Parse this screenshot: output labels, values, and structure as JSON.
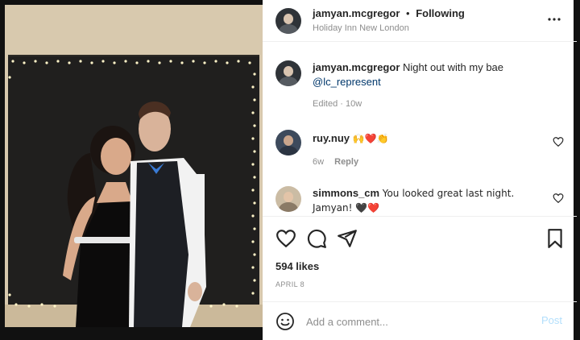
{
  "post": {
    "author": "jamyan.mcgregor",
    "separator": "•",
    "follow_status": "Following",
    "location": "Holiday Inn New London"
  },
  "caption": {
    "username": "jamyan.mcgregor",
    "text": "Night out with my bae",
    "mention": "@lc_represent",
    "edited": "Edited · 10w"
  },
  "comments": [
    {
      "username": "ruy.nuy",
      "text": "🙌❤️👏",
      "time": "6w",
      "reply_label": "Reply"
    },
    {
      "username": "simmons_cm",
      "text": "You looked great last night. Jamyan! 🖤❤️"
    }
  ],
  "likes": "594 likes",
  "date": "APRIL 8",
  "add_comment": {
    "placeholder": "Add a comment...",
    "post_label": "Post"
  },
  "colors": {
    "link": "#00376b",
    "post_button": "#b2dffc",
    "heart_red": "#e0245e"
  }
}
